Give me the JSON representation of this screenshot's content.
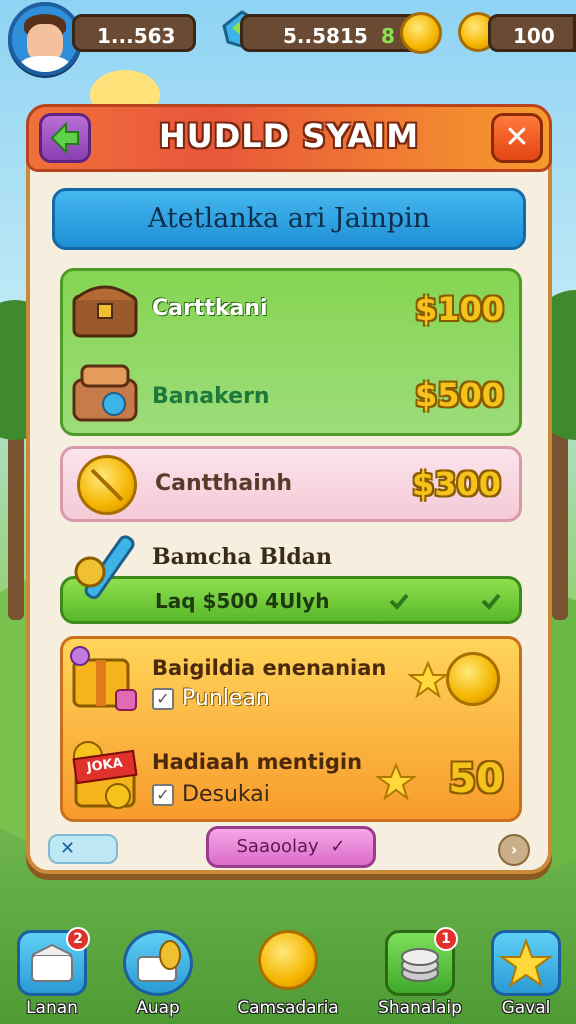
{
  "header": {
    "player_value": "1...563",
    "gems_value": "5..5815",
    "gems_extra": "8",
    "coins_value": "100"
  },
  "dialog": {
    "title": "HUDLD SYAIM",
    "close_symbol": "✕",
    "subtitle": "Atetlanka ari Jainpin",
    "items": [
      {
        "label": "Carttkani",
        "price": "$100"
      },
      {
        "label": "Banakern",
        "price": "$500"
      },
      {
        "label": "Cantthainh",
        "price": "$300"
      }
    ],
    "promo": {
      "title": "Bamcha Bldan",
      "detail": "Laq $500 4Ulyh"
    },
    "rewards": [
      {
        "title": "Baigildia enenanian",
        "check_label": "Punlean",
        "value": ""
      },
      {
        "title": "Hadiaah mentigin",
        "check_label": "Desukai",
        "value": "50",
        "tag": "JOKA"
      }
    ],
    "footer_button": "Saaoolay"
  },
  "nav": [
    {
      "label": "Lanan",
      "badge": "2",
      "icon": "box-icon"
    },
    {
      "label": "Auap",
      "badge": "",
      "icon": "basket-icon"
    },
    {
      "label": "Camsadaria",
      "badge": "",
      "icon": "coin-icon"
    },
    {
      "label": "Shanalaip",
      "badge": "1",
      "icon": "coin-stack-icon"
    },
    {
      "label": "Gaval",
      "badge": "",
      "icon": "star-icon"
    }
  ],
  "colors": {
    "accent_orange": "#f0713b",
    "accent_blue": "#1f8fd6",
    "accent_green": "#6cc23a",
    "gold": "#f6c21c"
  }
}
